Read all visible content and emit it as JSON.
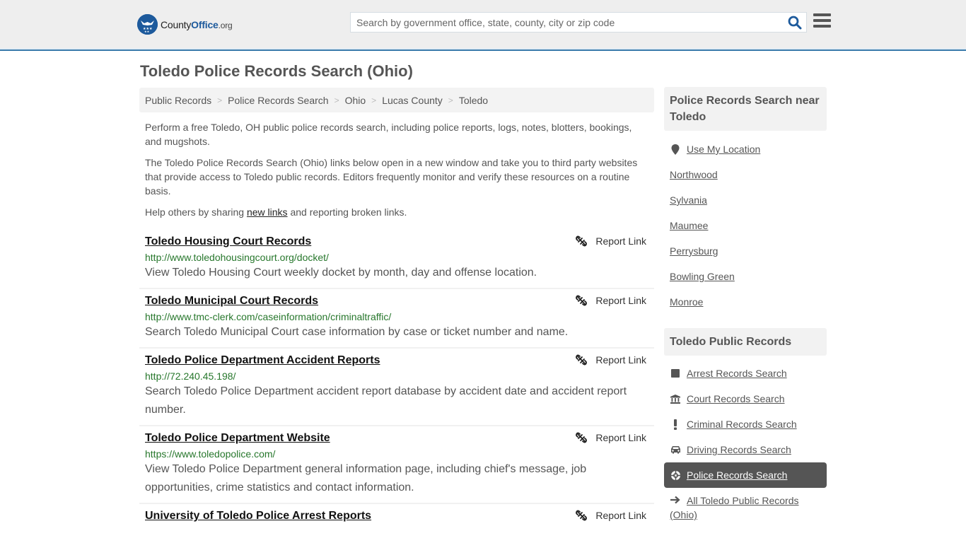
{
  "header": {
    "logo": {
      "brand_part1": "County",
      "brand_part2": "Office",
      "brand_tld": ".org"
    },
    "search_placeholder": "Search by government office, state, county, city or zip code",
    "search_icon": "magnifier-icon",
    "menu_icon": "hamburger-icon"
  },
  "page": {
    "title": "Toledo Police Records Search (Ohio)"
  },
  "breadcrumb": [
    {
      "label": "Public Records"
    },
    {
      "label": "Police Records Search"
    },
    {
      "label": "Ohio"
    },
    {
      "label": "Lucas County"
    },
    {
      "label": "Toledo"
    }
  ],
  "intro": {
    "p1": "Perform a free Toledo, OH public police records search, including police reports, logs, notes, blotters, bookings, and mugshots.",
    "p2": "The Toledo Police Records Search (Ohio) links below open in a new window and take you to third party websites that provide access to Toledo public records. Editors frequently monitor and verify these resources on a routine basis.",
    "p3_before": "Help others by sharing ",
    "p3_link": "new links",
    "p3_after": " and reporting broken links."
  },
  "results": [
    {
      "title": "Toledo Housing Court Records",
      "url": "http://www.toledohousingcourt.org/docket/",
      "description": "View Toledo Housing Court weekly docket by month, day and offense location.",
      "report_label": "Report Link"
    },
    {
      "title": "Toledo Municipal Court Records",
      "url": "http://www.tmc-clerk.com/caseinformation/criminaltraffic/",
      "description": "Search Toledo Municipal Court case information by case or ticket number and name.",
      "report_label": "Report Link"
    },
    {
      "title": "Toledo Police Department Accident Reports",
      "url": "http://72.240.45.198/",
      "description": "Search Toledo Police Department accident report database by accident date and accident report number.",
      "report_label": "Report Link"
    },
    {
      "title": "Toledo Police Department Website",
      "url": "https://www.toledopolice.com/",
      "description": "View Toledo Police Department general information page, including chief's message, job opportunities, crime statistics and contact information.",
      "report_label": "Report Link"
    },
    {
      "title": "University of Toledo Police Arrest Reports",
      "url": "",
      "description": "",
      "report_label": "Report Link"
    }
  ],
  "sidebar": {
    "nearby": {
      "heading": "Police Records Search near Toledo",
      "use_location": "Use My Location",
      "cities": [
        "Northwood",
        "Sylvania",
        "Maumee",
        "Perrysburg",
        "Bowling Green",
        "Monroe"
      ]
    },
    "public_records": {
      "heading": "Toledo Public Records",
      "items": [
        {
          "label": "Arrest Records Search",
          "icon": "square-icon"
        },
        {
          "label": "Court Records Search",
          "icon": "courthouse-icon"
        },
        {
          "label": "Criminal Records Search",
          "icon": "exclamation-icon"
        },
        {
          "label": "Driving Records Search",
          "icon": "car-icon"
        },
        {
          "label": "Police Records Search",
          "icon": "crosshair-icon",
          "active": true
        },
        {
          "label": "All Toledo Public Records (Ohio)",
          "icon": "arrow-right-icon"
        }
      ]
    }
  },
  "colors": {
    "accent_blue": "#1d5a9c",
    "header_border": "#3a7bab",
    "url_green": "#27772c",
    "active_item_bg": "#555555"
  }
}
